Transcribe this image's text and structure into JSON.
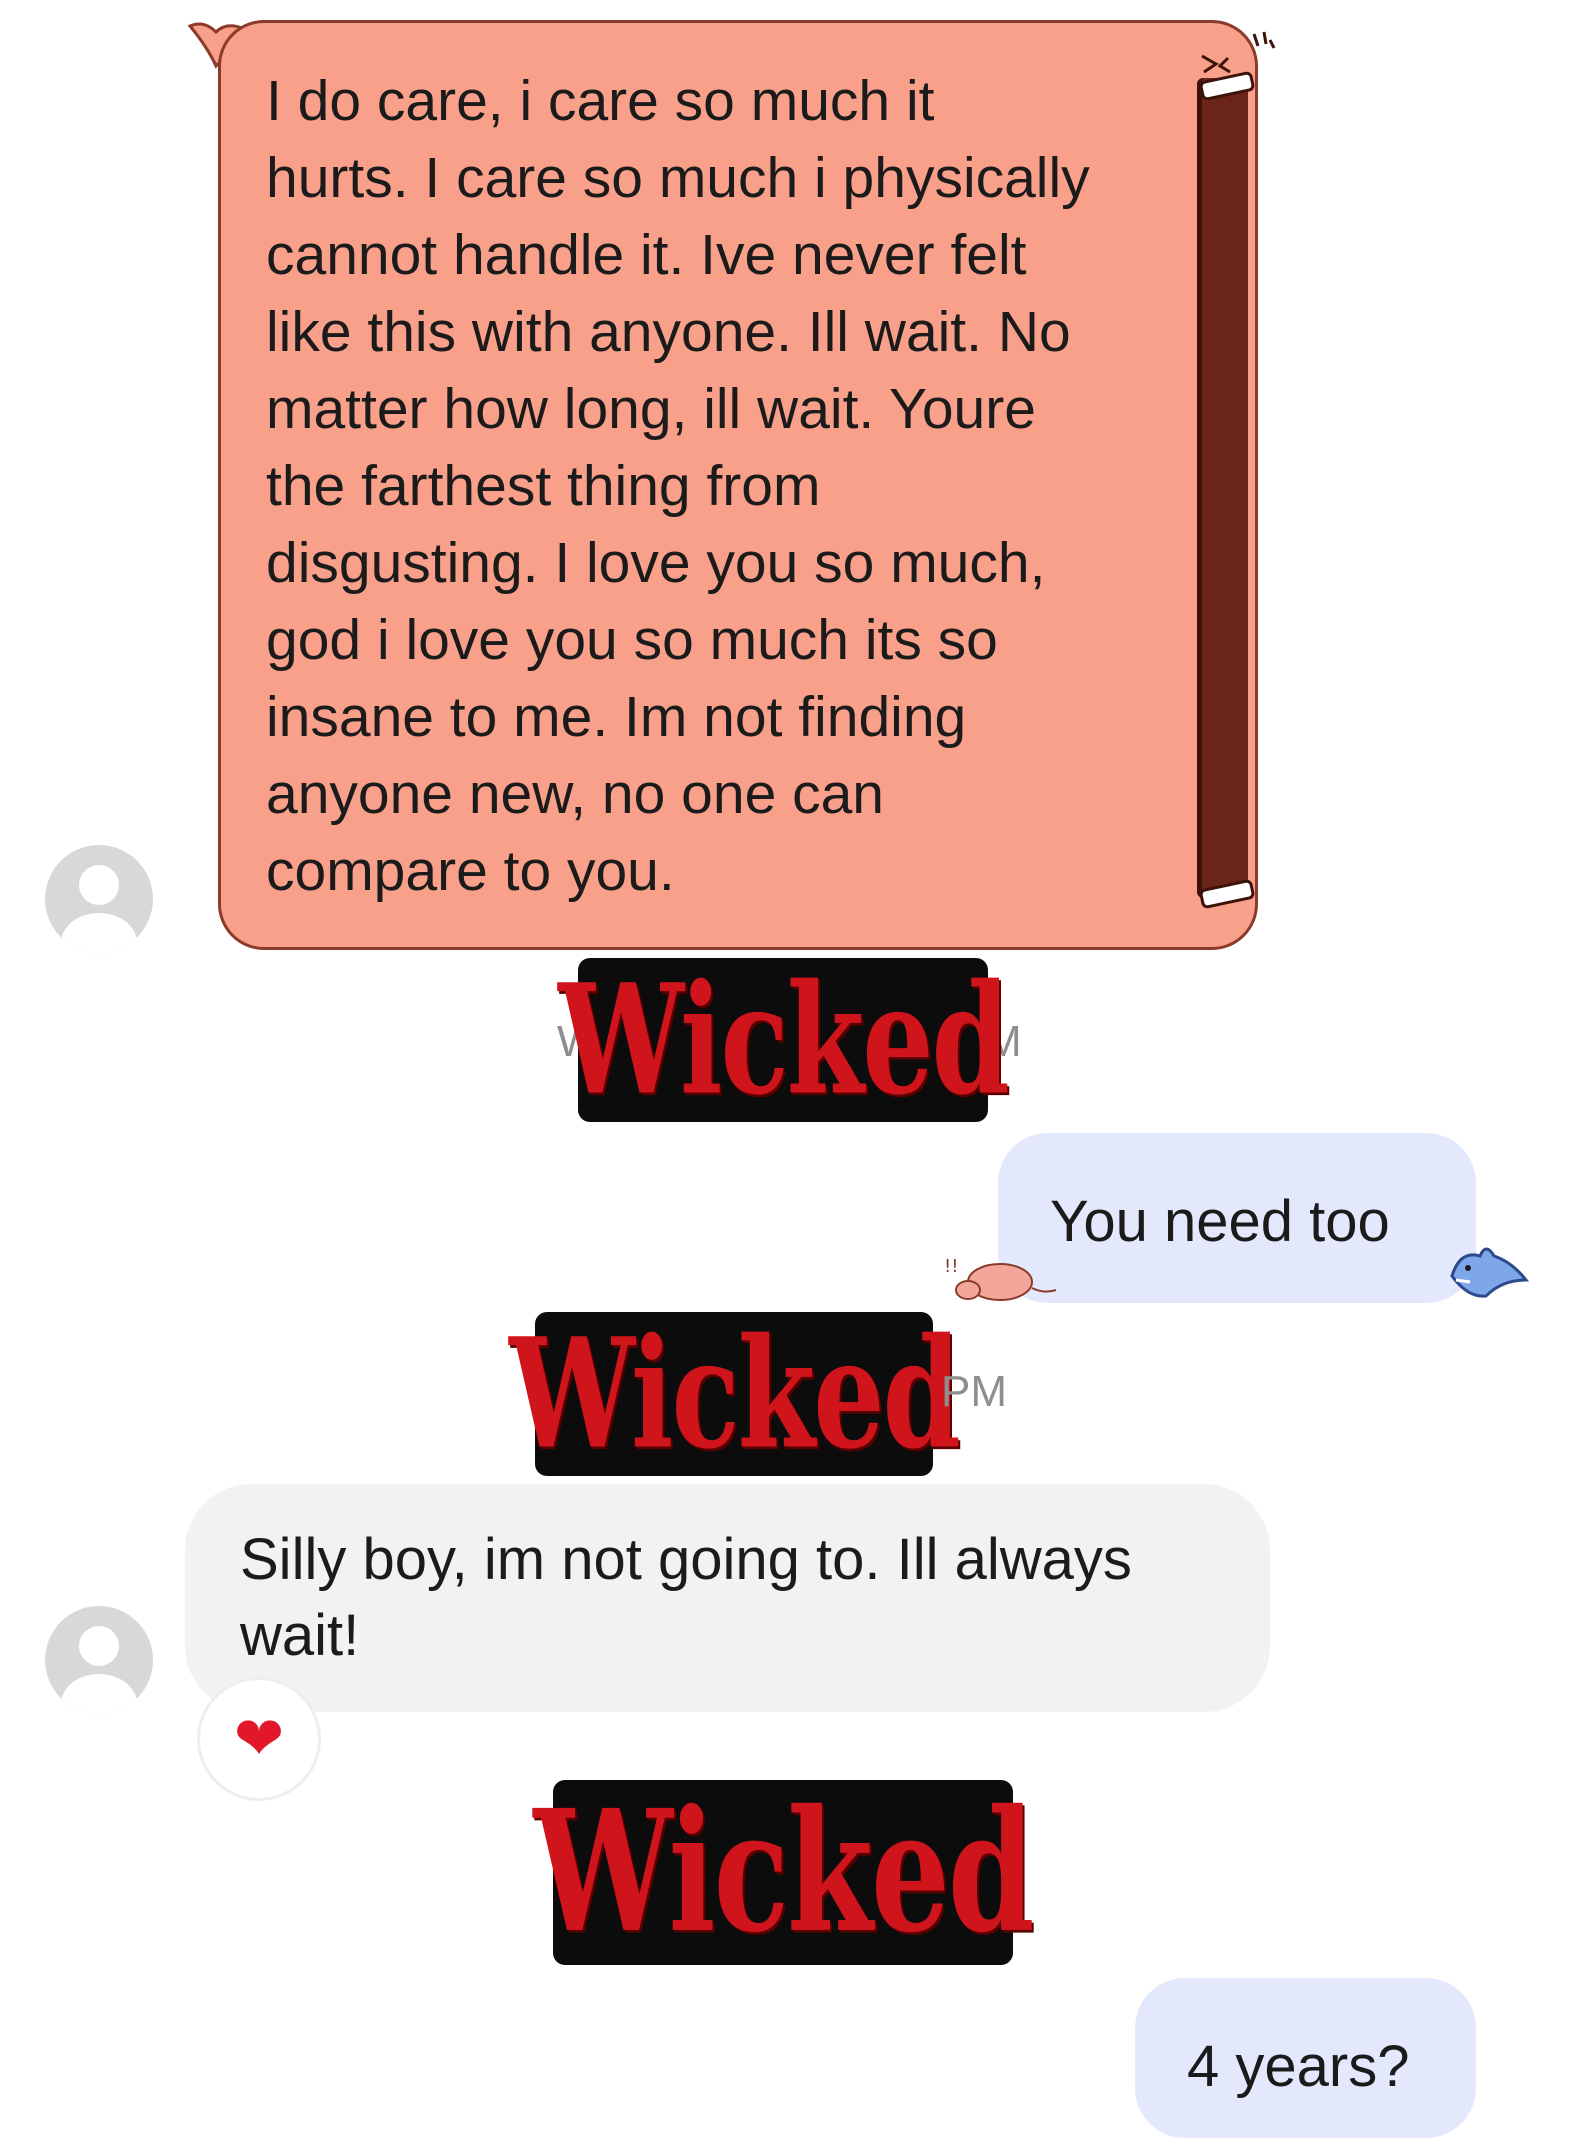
{
  "messages": {
    "incoming_long": "I do care, i care so much it\nhurts. I care so much i physically\ncannot handle it. Ive never felt\nlike this with anyone. Ill wait. No\nmatter how long, ill wait. Youre\nthe farthest thing from\ndisgusting. I love you so much,\ngod i love you so much its so\ninsane to me. Im not finding\nanyone new, no one can\ncompare to you.",
    "outgoing_1": "You need too",
    "incoming_2": "Silly boy, im not going to. Ill always\nwait!",
    "outgoing_2": "4 years?"
  },
  "timestamps": {
    "first_left": "W",
    "first_right": "M",
    "second": "PM"
  },
  "stickers": {
    "label": "Wicked",
    "text_color": "#d0141b",
    "bg_color": "#0c0c0c"
  },
  "reaction": {
    "emoji": "❤",
    "icon": "heart-icon"
  },
  "colors": {
    "big_bubble": "#f9a08a",
    "outgoing_bubble": "#e3e8fd",
    "incoming_bubble": "#f2f2f2"
  }
}
